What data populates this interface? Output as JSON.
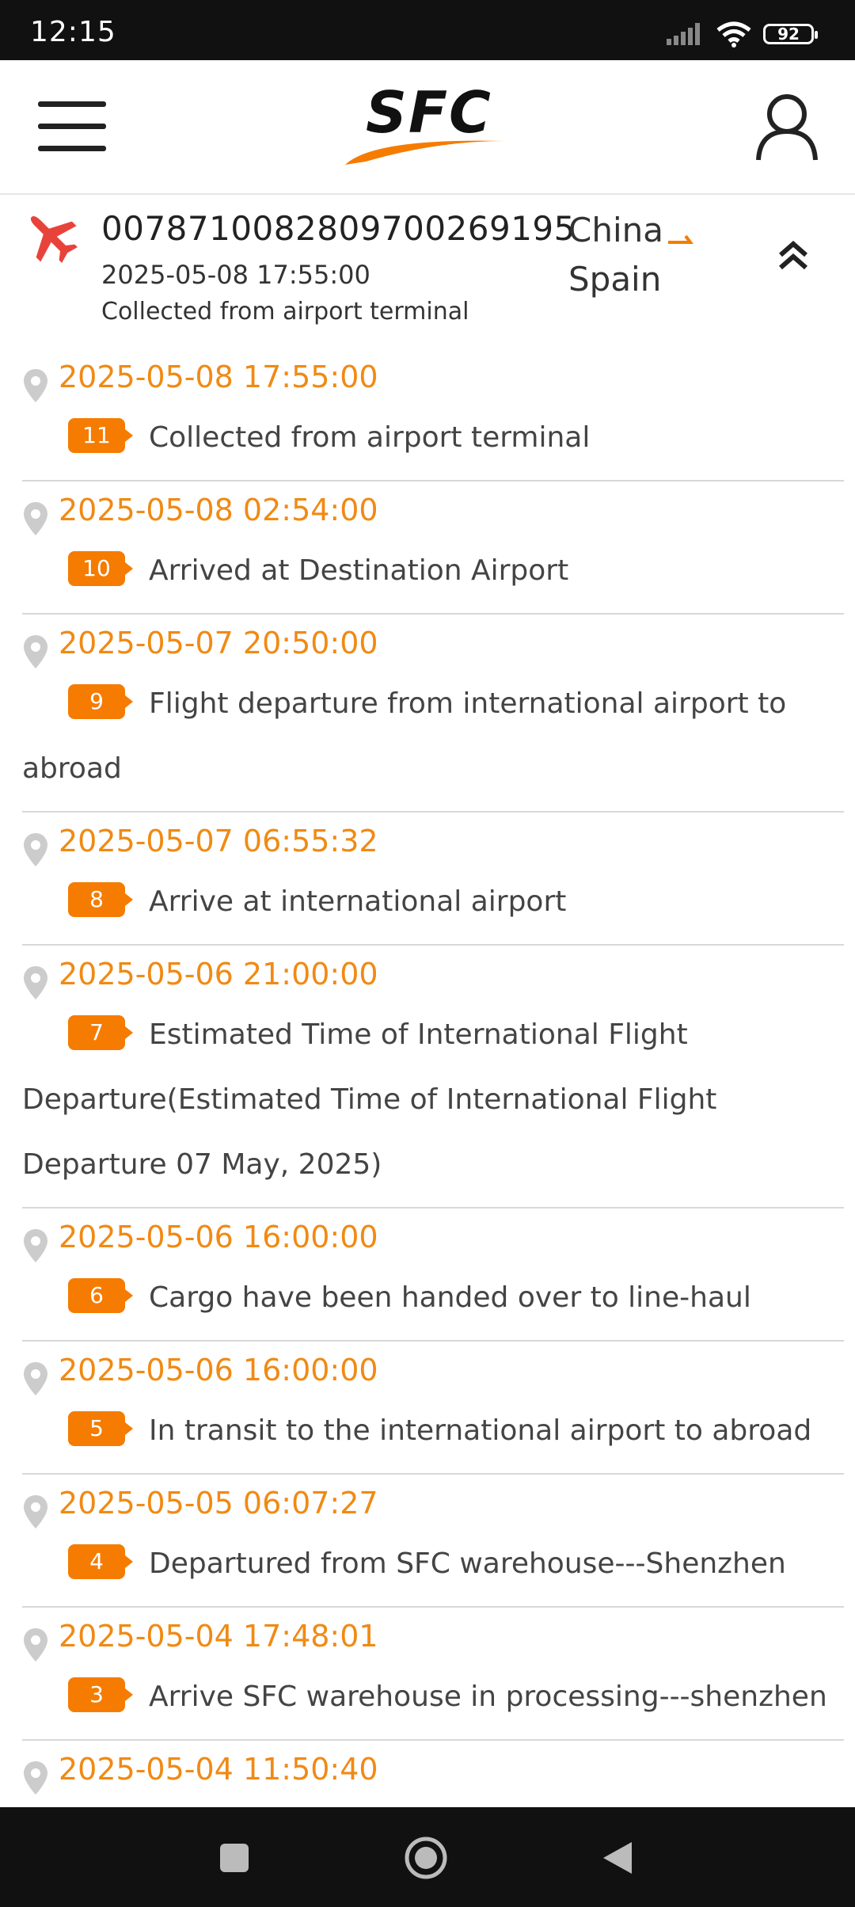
{
  "status_bar": {
    "time": "12:15",
    "battery": "92"
  },
  "header": {
    "logo_text": "SFC"
  },
  "shipment": {
    "tracking_number": "0078710082809700269195",
    "latest_date": "2025-05-08 17:55:00",
    "latest_status": "Collected from airport terminal",
    "origin": "China",
    "destination": "Spain"
  },
  "events": [
    {
      "date": "2025-05-08 17:55:00",
      "step": "11",
      "text": "Collected from airport terminal"
    },
    {
      "date": "2025-05-08 02:54:00",
      "step": "10",
      "text": "Arrived at Destination Airport"
    },
    {
      "date": "2025-05-07 20:50:00",
      "step": "9",
      "text": "Flight departure from international airport to abroad"
    },
    {
      "date": "2025-05-07 06:55:32",
      "step": "8",
      "text": "Arrive at international airport"
    },
    {
      "date": "2025-05-06 21:00:00",
      "step": "7",
      "text": "Estimated Time of International Flight Departure(Estimated Time of International Flight Departure 07 May, 2025)"
    },
    {
      "date": "2025-05-06 16:00:00",
      "step": "6",
      "text": "Cargo have been handed over to line-haul"
    },
    {
      "date": "2025-05-06 16:00:00",
      "step": "5",
      "text": "In transit to the international airport to abroad"
    },
    {
      "date": "2025-05-05 06:07:27",
      "step": "4",
      "text": "Departured from SFC warehouse---Shenzhen"
    },
    {
      "date": "2025-05-04 17:48:01",
      "step": "3",
      "text": "Arrive SFC warehouse in processing---shenzhen"
    },
    {
      "date": "2025-05-04 11:50:40",
      "step": "",
      "text": ""
    }
  ],
  "colors": {
    "accent": "#f57c00",
    "date_text": "#f08a14",
    "plane": "#e8433a"
  }
}
